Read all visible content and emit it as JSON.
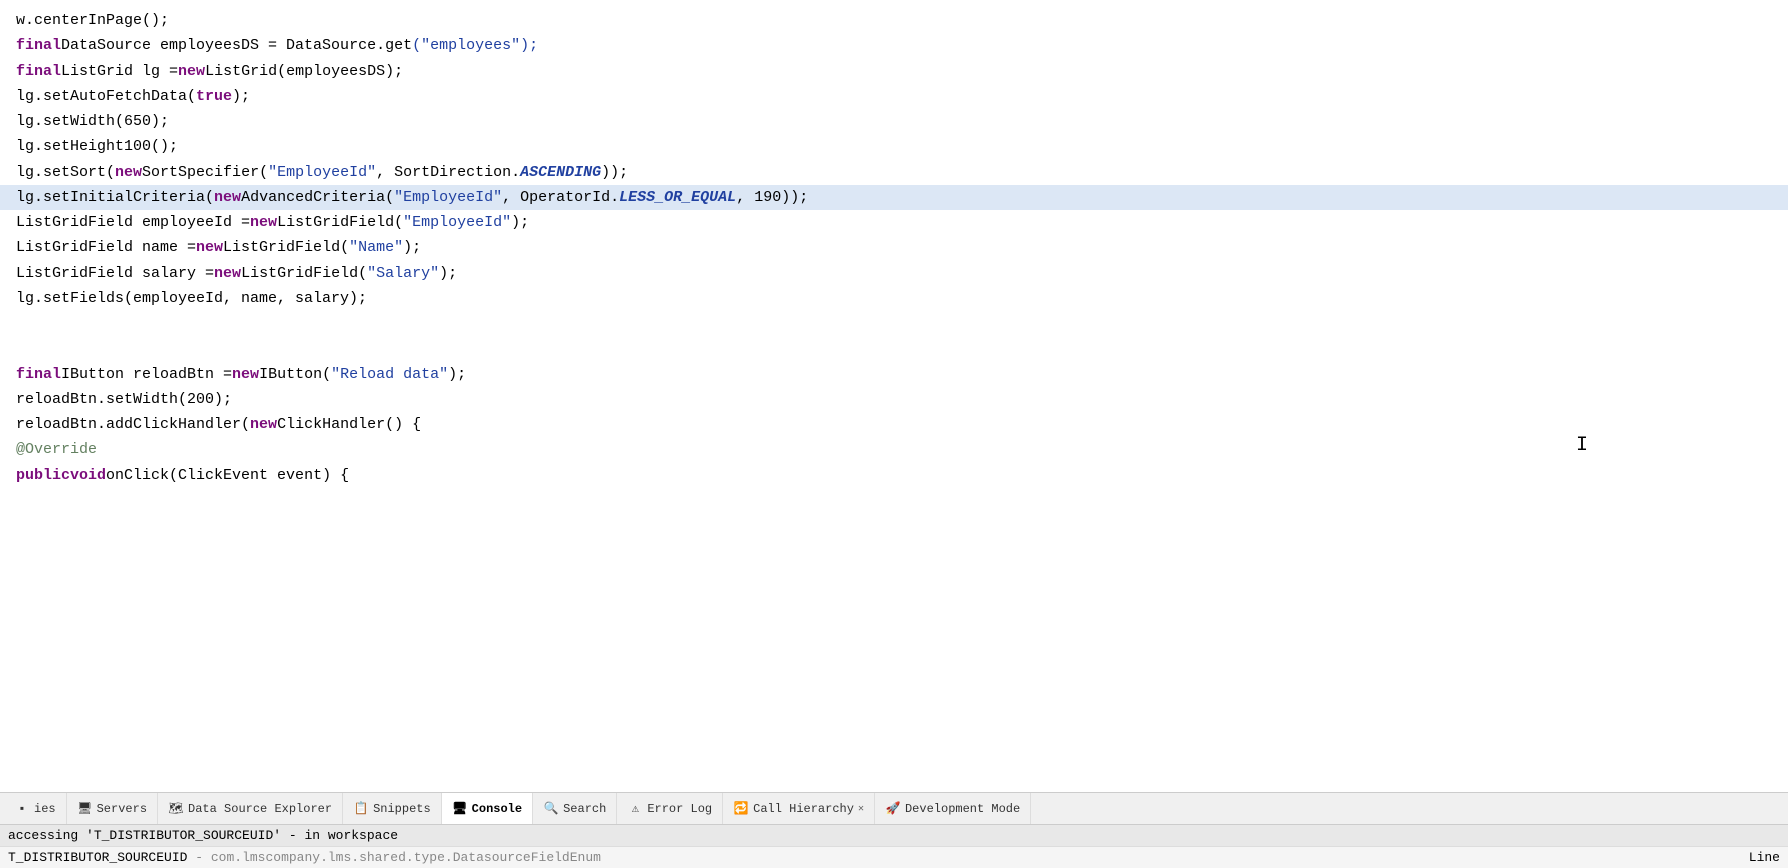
{
  "code": {
    "lines": [
      {
        "id": "line1",
        "highlighted": false,
        "tokens": [
          {
            "text": "w.centerInPage();",
            "class": "plain"
          }
        ]
      },
      {
        "id": "line2",
        "highlighted": false,
        "tokens": [
          {
            "text": "final",
            "class": "kw"
          },
          {
            "text": " DataSource employeesDS = DataSource.",
            "class": "plain"
          },
          {
            "text": "get",
            "class": "plain"
          },
          {
            "text": "(\"employees\");",
            "class": "str"
          }
        ]
      },
      {
        "id": "line3",
        "highlighted": false,
        "tokens": [
          {
            "text": "final",
            "class": "kw"
          },
          {
            "text": " ListGrid lg = ",
            "class": "plain"
          },
          {
            "text": "new",
            "class": "kw"
          },
          {
            "text": " ListGrid(employeesDS);",
            "class": "plain"
          }
        ]
      },
      {
        "id": "line4",
        "highlighted": false,
        "tokens": [
          {
            "text": "lg.setAutoFetchData(",
            "class": "plain"
          },
          {
            "text": "true",
            "class": "kw"
          },
          {
            "text": ");",
            "class": "plain"
          }
        ]
      },
      {
        "id": "line5",
        "highlighted": false,
        "tokens": [
          {
            "text": "lg.setWidth(650);",
            "class": "plain"
          }
        ]
      },
      {
        "id": "line6",
        "highlighted": false,
        "tokens": [
          {
            "text": "lg.setHeight100();",
            "class": "plain"
          }
        ]
      },
      {
        "id": "line7",
        "highlighted": false,
        "tokens": [
          {
            "text": "lg.setSort(",
            "class": "plain"
          },
          {
            "text": "new",
            "class": "kw"
          },
          {
            "text": " SortSpecifier(",
            "class": "plain"
          },
          {
            "text": "\"EmployeeId\"",
            "class": "str"
          },
          {
            "text": ", SortDirection.",
            "class": "plain"
          },
          {
            "text": "ASCENDING",
            "class": "bold-italic"
          },
          {
            "text": "));",
            "class": "plain"
          }
        ]
      },
      {
        "id": "line8",
        "highlighted": true,
        "tokens": [
          {
            "text": "lg.setInitialCriteria(",
            "class": "plain"
          },
          {
            "text": "new",
            "class": "kw"
          },
          {
            "text": " AdvancedCriteria(",
            "class": "plain"
          },
          {
            "text": "\"EmployeeId\"",
            "class": "str"
          },
          {
            "text": ", OperatorId.",
            "class": "plain"
          },
          {
            "text": "LESS_OR_EQUAL",
            "class": "bold-italic"
          },
          {
            "text": ", 190));",
            "class": "plain"
          }
        ]
      },
      {
        "id": "line9",
        "highlighted": false,
        "tokens": [
          {
            "text": "ListGridField employeeId = ",
            "class": "plain"
          },
          {
            "text": "new",
            "class": "kw"
          },
          {
            "text": " ListGridField(",
            "class": "plain"
          },
          {
            "text": "\"EmployeeId\"",
            "class": "str"
          },
          {
            "text": ");",
            "class": "plain"
          }
        ]
      },
      {
        "id": "line10",
        "highlighted": false,
        "tokens": [
          {
            "text": "ListGridField name = ",
            "class": "plain"
          },
          {
            "text": "new",
            "class": "kw"
          },
          {
            "text": " ListGridField(",
            "class": "plain"
          },
          {
            "text": "\"Name\"",
            "class": "str"
          },
          {
            "text": ");",
            "class": "plain"
          }
        ]
      },
      {
        "id": "line11",
        "highlighted": false,
        "tokens": [
          {
            "text": "ListGridField salary = ",
            "class": "plain"
          },
          {
            "text": "new",
            "class": "kw"
          },
          {
            "text": " ListGridField(",
            "class": "plain"
          },
          {
            "text": "\"Salary\"",
            "class": "str"
          },
          {
            "text": ");",
            "class": "plain"
          }
        ]
      },
      {
        "id": "line12",
        "highlighted": false,
        "tokens": [
          {
            "text": "lg.setFields(employeeId, name, salary);",
            "class": "plain"
          }
        ]
      },
      {
        "id": "line13",
        "highlighted": false,
        "tokens": [
          {
            "text": "",
            "class": "plain"
          }
        ]
      },
      {
        "id": "line14",
        "highlighted": false,
        "tokens": [
          {
            "text": "",
            "class": "plain"
          }
        ]
      },
      {
        "id": "line15",
        "highlighted": false,
        "tokens": [
          {
            "text": "final",
            "class": "kw"
          },
          {
            "text": " IButton reloadBtn = ",
            "class": "plain"
          },
          {
            "text": "new",
            "class": "kw"
          },
          {
            "text": " IButton(",
            "class": "plain"
          },
          {
            "text": "\"Reload data\"",
            "class": "str"
          },
          {
            "text": ");",
            "class": "plain"
          }
        ]
      },
      {
        "id": "line16",
        "highlighted": false,
        "tokens": [
          {
            "text": "reloadBtn.setWidth(200);",
            "class": "plain"
          }
        ]
      },
      {
        "id": "line17",
        "highlighted": false,
        "tokens": [
          {
            "text": "reloadBtn.addClickHandler(",
            "class": "plain"
          },
          {
            "text": "new",
            "class": "kw"
          },
          {
            "text": " ClickHandler() {",
            "class": "plain"
          }
        ]
      },
      {
        "id": "line18",
        "highlighted": false,
        "tokens": [
          {
            "text": "    @Override",
            "class": "annotation"
          }
        ]
      },
      {
        "id": "line19",
        "highlighted": false,
        "tokens": [
          {
            "text": "    ",
            "class": "plain"
          },
          {
            "text": "public",
            "class": "kw"
          },
          {
            "text": " ",
            "class": "plain"
          },
          {
            "text": "void",
            "class": "kw"
          },
          {
            "text": " onClick(ClickEvent event) {",
            "class": "plain"
          }
        ]
      }
    ]
  },
  "tabs": [
    {
      "id": "tab-ies",
      "label": "ies",
      "icon": "ies-icon",
      "active": false,
      "closable": false
    },
    {
      "id": "tab-servers",
      "label": "Servers",
      "icon": "servers-icon",
      "active": false,
      "closable": false
    },
    {
      "id": "tab-datasource",
      "label": "Data Source Explorer",
      "icon": "datasource-icon",
      "active": false,
      "closable": false
    },
    {
      "id": "tab-snippets",
      "label": "Snippets",
      "icon": "snippets-icon",
      "active": false,
      "closable": false
    },
    {
      "id": "tab-console",
      "label": "Console",
      "icon": "console-icon",
      "active": true,
      "closable": false
    },
    {
      "id": "tab-search",
      "label": "Search",
      "icon": "search-icon",
      "active": false,
      "closable": false
    },
    {
      "id": "tab-errorlog",
      "label": "Error Log",
      "icon": "errorlog-icon",
      "active": false,
      "closable": false
    },
    {
      "id": "tab-callhierarchy",
      "label": "Call Hierarchy",
      "icon": "callhierarchy-icon",
      "active": false,
      "closable": true
    },
    {
      "id": "tab-devmode",
      "label": "Development Mode",
      "icon": "devmode-icon",
      "active": false,
      "closable": false
    }
  ],
  "statusbar": {
    "line1": "accessing 'T_DISTRIBUTOR_SOURCEUID' - in workspace",
    "line2_left": "T_DISTRIBUTOR_SOURCEUID",
    "line2_separator": " - ",
    "line2_path": "com.lmscompany.lms.shared.type.DatasourceFieldEnum",
    "line2_right": "Line"
  }
}
